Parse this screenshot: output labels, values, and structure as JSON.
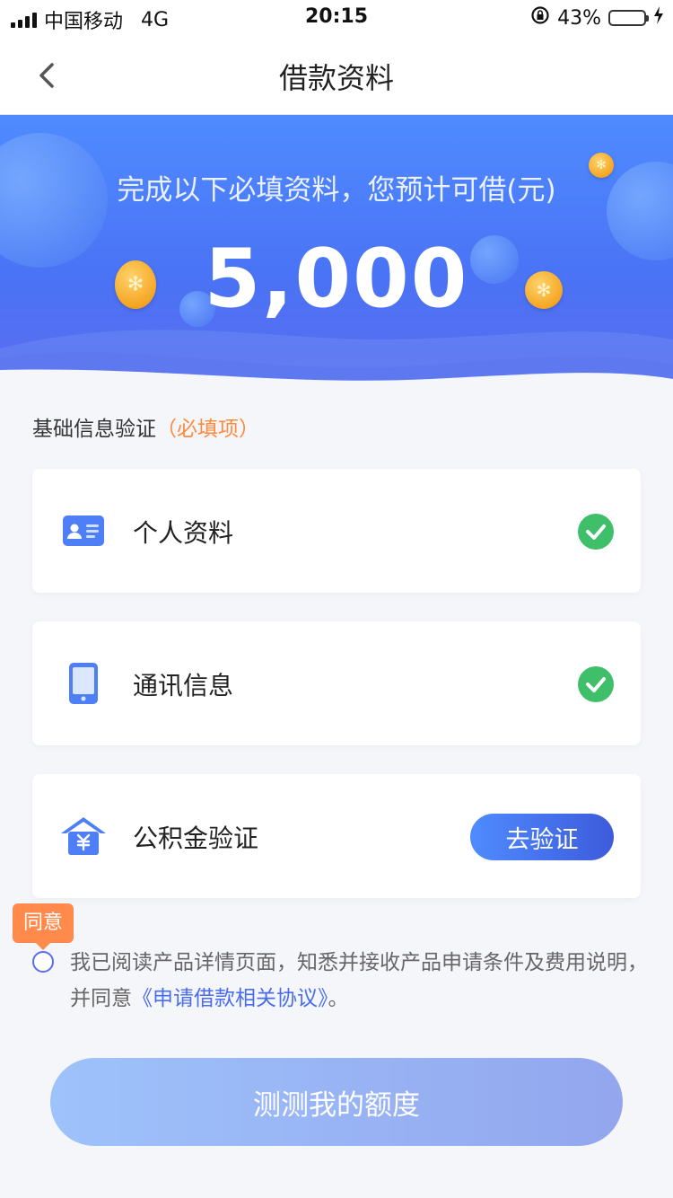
{
  "status_bar": {
    "carrier": "中国移动",
    "network": "4G",
    "time": "20:15",
    "battery": "43%",
    "battery_level": 0.43
  },
  "nav": {
    "title": "借款资料",
    "back_icon": "chevron-left-icon"
  },
  "hero": {
    "subtitle": "完成以下必填资料，您预计可借(元)",
    "amount": "5,000"
  },
  "section": {
    "title": "基础信息验证",
    "required_tag": "（必填项）"
  },
  "items": [
    {
      "label": "个人资料",
      "icon": "id-card-icon",
      "status": "done"
    },
    {
      "label": "通讯信息",
      "icon": "phone-icon",
      "status": "done"
    },
    {
      "label": "公积金验证",
      "icon": "house-fund-icon",
      "status": "pending",
      "action": "去验证"
    }
  ],
  "agreement": {
    "tip": "同意",
    "text": "我已阅读产品详情页面，知悉并接收产品申请条件及费用说明，并同意",
    "link": "《申请借款相关协议》",
    "suffix": "。"
  },
  "submit": {
    "label": "测测我的额度"
  },
  "colors": {
    "primary": "#4a73f5",
    "success": "#3fbf6a",
    "accent": "#ff8a3d"
  }
}
